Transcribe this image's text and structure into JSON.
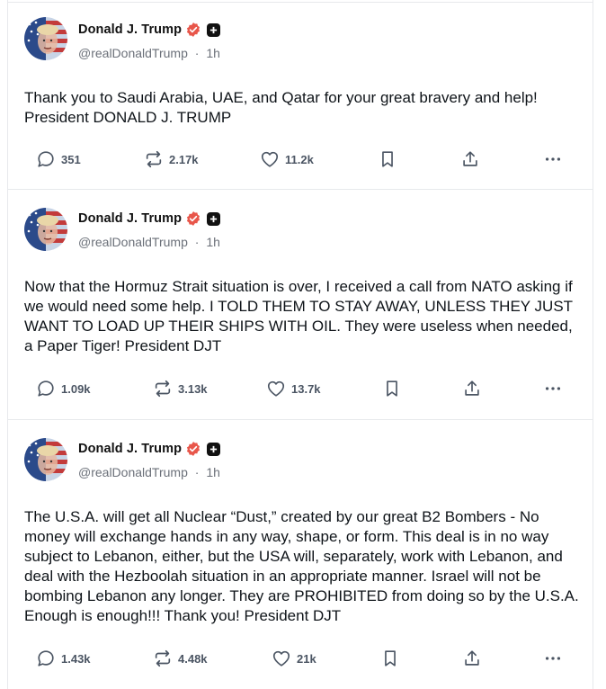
{
  "posts": [
    {
      "author": "Donald J. Trump",
      "handle": "@realDonaldTrump",
      "time": "1h",
      "text": "Thank you to Saudi Arabia, UAE, and Qatar for your great bravery and help! President DONALD J. TRUMP",
      "replies": "351",
      "reposts": "2.17k",
      "likes": "11.2k"
    },
    {
      "author": "Donald J. Trump",
      "handle": "@realDonaldTrump",
      "time": "1h",
      "text": "Now that the Hormuz Strait situation is over, I received a call from NATO asking if we would need some help. I  TOLD THEM TO STAY AWAY, UNLESS THEY JUST WANT TO LOAD UP THEIR SHIPS WITH OIL. They were useless when needed, a Paper Tiger! President DJT",
      "replies": "1.09k",
      "reposts": "3.13k",
      "likes": "13.7k"
    },
    {
      "author": "Donald J. Trump",
      "handle": "@realDonaldTrump",
      "time": "1h",
      "text": "The U.S.A. will get all Nuclear “Dust,” created by our great B2 Bombers - No money will exchange hands in any way, shape, or form. This deal is in no way subject to Lebanon, either, but the USA will, separately, work with Lebanon, and deal with the Hezboolah situation in an appropriate manner. Israel will not be bombing Lebanon any longer. They are PROHIBITED from doing so by the U.S.A. Enough is enough!!! Thank you! President DJT",
      "replies": "1.43k",
      "reposts": "4.48k",
      "likes": "21k"
    }
  ],
  "separator": "·",
  "icons": {
    "reply": "reply-icon",
    "repost": "repost-icon",
    "like": "heart-icon",
    "bookmark": "bookmark-icon",
    "share": "share-icon",
    "more": "more-icon",
    "verified": "verified-badge-icon",
    "plus": "plus-badge-icon"
  },
  "colors": {
    "verified": "#e8564a",
    "text": "#0f1419",
    "muted": "#6b7079",
    "border": "#e7e9ec"
  }
}
